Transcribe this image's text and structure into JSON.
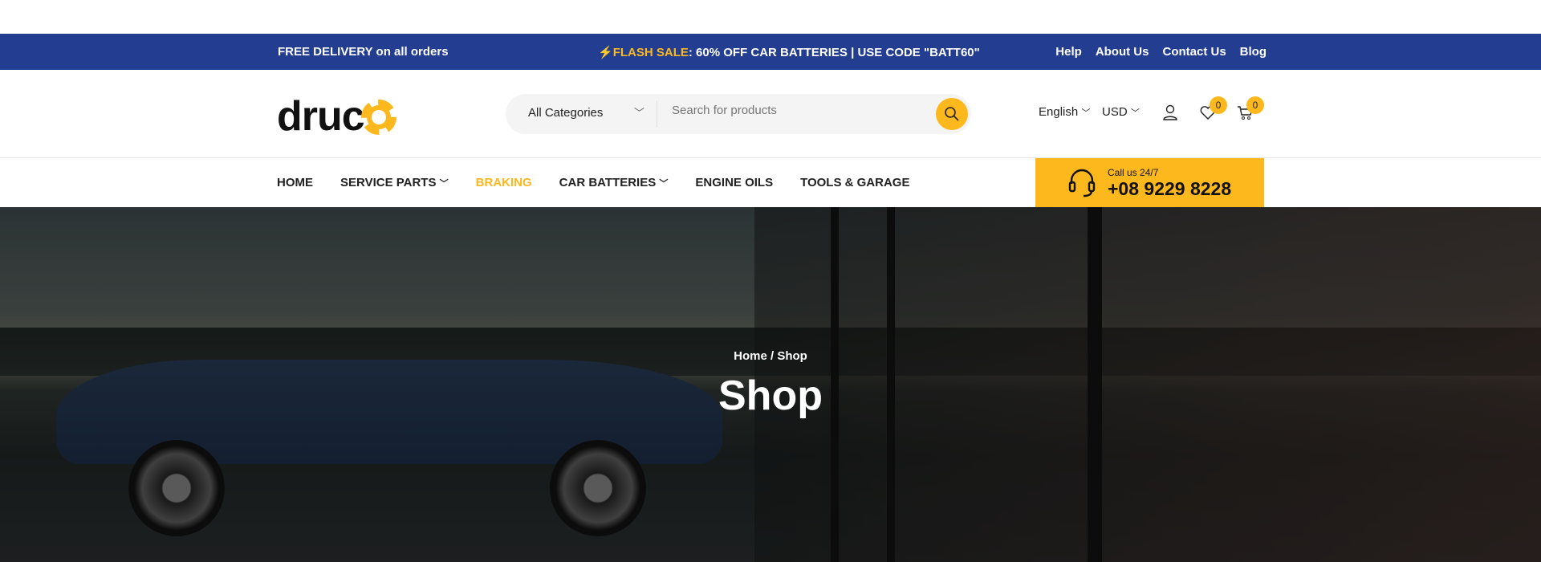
{
  "topbar": {
    "delivery": "FREE DELIVERY on all orders",
    "flash_label": "FLASH SALE",
    "flash_text": ": 60% OFF CAR BATTERIES | USE CODE \"BATT60\"",
    "links": [
      "Help",
      "About Us",
      "Contact Us",
      "Blog"
    ]
  },
  "header": {
    "logo": "druc",
    "logo_o": "o",
    "category": "All Categories",
    "search_placeholder": "Search for products",
    "language": "English",
    "currency": "USD",
    "wishlist_count": "0",
    "cart_count": "0"
  },
  "nav": {
    "items": [
      "HOME",
      "SERVICE PARTS",
      "BRAKING",
      "CAR BATTERIES",
      "ENGINE OILS",
      "TOOLS & GARAGE"
    ],
    "active": "BRAKING",
    "call_label": "Call us 24/7",
    "phone": "+08 9229 8228"
  },
  "hero": {
    "breadcrumb_home": "Home",
    "breadcrumb_sep": "/",
    "breadcrumb_current": "Shop",
    "title": "Shop"
  },
  "colors": {
    "primary": "#233e91",
    "accent": "#fdb81e"
  }
}
